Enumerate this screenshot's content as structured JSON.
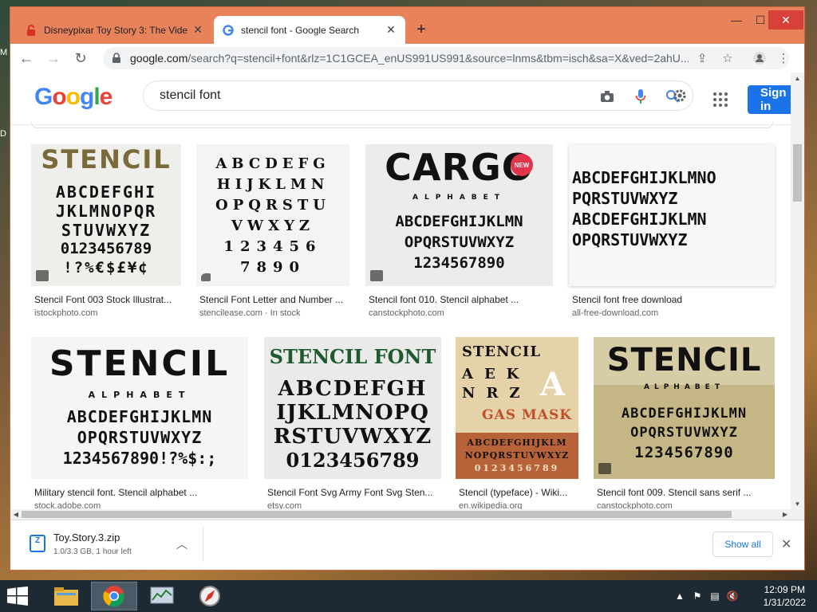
{
  "browser": {
    "tabs": [
      {
        "title": "Disneypixar Toy Story 3: The Vide",
        "icon": "lock-red-icon"
      },
      {
        "title": "stencil font - Google Search",
        "icon": "google-g-icon"
      }
    ],
    "url_host": "google.com",
    "url_rest": "/search?q=stencil+font&rlz=1C1GCEA_enUS991US991&source=lnms&tbm=isch&sa=X&ved=2ahU..."
  },
  "search": {
    "logo": [
      "G",
      "o",
      "o",
      "g",
      "l",
      "e"
    ],
    "logo_colors": [
      "#4285F4",
      "#EA4335",
      "#FBBC05",
      "#4285F4",
      "#34A853",
      "#EA4335"
    ],
    "query": "stencil font",
    "signin_label": "Sign in"
  },
  "results": [
    {
      "title": "Stencil Font 003 Stock Illustrat...",
      "source": "istockphoto.com",
      "big": "STENCIL",
      "rows": [
        "ABCDEFGHI",
        "JKLMNOPQR",
        "STUVWXYZ",
        "0123456789",
        "!?%€$£¥¢"
      ]
    },
    {
      "title": "Stencil Font Letter and Number ...",
      "source": "stencilease.com · In stock",
      "big": "",
      "rows": [
        "ABCDEFG",
        "HIJKLMN",
        "OPQRSTU",
        "VWXYZ",
        "123456",
        "7890"
      ]
    },
    {
      "title": "Stencil font 010. Stencil alphabet ...",
      "source": "canstockphoto.com",
      "big": "CARGO",
      "sub": "ALPHABET",
      "rows": [
        "ABCDEFGHIJKLMN",
        "OPQRSTUVWXYZ",
        "1234567890"
      ]
    },
    {
      "title": "Stencil font free download",
      "source": "all-free-download.com",
      "big": "",
      "rows": [
        "ABCDEFGHIJKLMNO",
        "PQRSTUVWXYZ",
        "ABCDEFGHIJKLMN",
        "OPQRSTUVWXYZ"
      ]
    },
    {
      "title": "Military stencil font. Stencil alphabet ...",
      "source": "stock.adobe.com",
      "big": "STENCIL",
      "sub": "ALPHABET",
      "rows": [
        "ABCDEFGHIJKLMN",
        "OPQRSTUVWXYZ",
        "1234567890!?%$:;"
      ]
    },
    {
      "title": "Stencil Font Svg Army Font Svg Sten...",
      "source": "etsy.com",
      "big": "STENCIL FONT",
      "rows": [
        "ABCDEFGH",
        "IJKLMNOPQ",
        "RSTUVWXYZ",
        "0123456789"
      ]
    },
    {
      "title": "Stencil (typeface) - Wiki...",
      "source": "en.wikipedia.org",
      "big": "STENCIL",
      "rows": [
        "AEK",
        "NRZ",
        "GAS MASK",
        "ABCDEFGHIJKLM",
        "NOPQRSTUVWXYZ",
        "0123456789"
      ]
    },
    {
      "title": "Stencil font 009. Stencil sans serif ...",
      "source": "canstockphoto.com",
      "big": "STENCIL",
      "sub": "ALPHABET",
      "rows": [
        "ABCDEFGHIJKLMN",
        "OPQRSTUVWXYZ",
        "1234567890"
      ]
    }
  ],
  "download": {
    "filename": "Toy.Story.3.zip",
    "status": "1.0/3.3 GB, 1 hour left",
    "show_all": "Show all"
  },
  "taskbar": {
    "time": "12:09 PM",
    "date": "1/31/2022"
  },
  "colors": {
    "window_frame": "#e8825a",
    "google_blue": "#1a73e8"
  }
}
